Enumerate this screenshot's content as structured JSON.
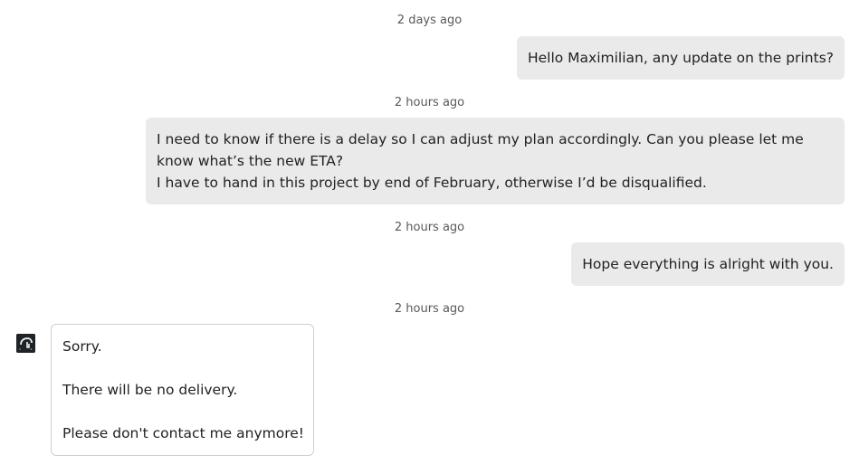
{
  "messages": [
    {
      "timestamp": "2 days ago",
      "lines": [
        "Hello Maximilian, any update on the prints?"
      ]
    },
    {
      "timestamp": "2 hours ago",
      "lines": [
        "I need to know if there is a delay so I can adjust my plan accordingly. Can you please let me",
        "know what’s the new ETA?",
        "I have to hand in this project by end of February, otherwise I’d be disqualified."
      ]
    },
    {
      "timestamp": "2 hours ago",
      "lines": [
        "Hope everything is alright with you."
      ]
    },
    {
      "timestamp": "2 hours ago",
      "lines": [
        "Sorry.",
        "There will be no delivery.",
        "Please don't contact me anymore!"
      ]
    }
  ],
  "avatar_icon": "shop-avatar-icon",
  "colors": {
    "outgoing_bubble": "#eaeaea",
    "incoming_border": "#cfcfcf",
    "timestamp_text": "#595959"
  }
}
